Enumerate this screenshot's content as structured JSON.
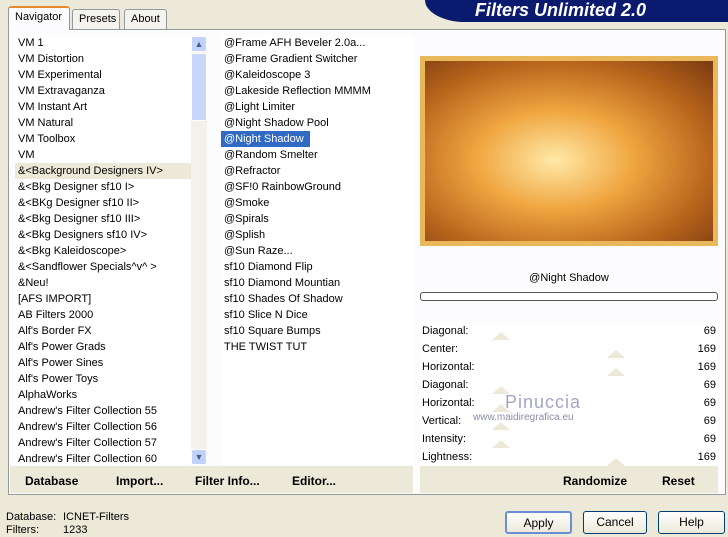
{
  "title": "Filters Unlimited 2.0",
  "tabs": [
    {
      "label": "Navigator",
      "active": true
    },
    {
      "label": "Presets"
    },
    {
      "label": "About"
    }
  ],
  "categories": [
    "VM 1",
    "VM Distortion",
    "VM Experimental",
    "VM Extravaganza",
    "VM Instant Art",
    "VM Natural",
    "VM Toolbox",
    "VM",
    "&<Background Designers IV>",
    "&<Bkg Designer sf10 I>",
    "&<BKg Designer sf10 II>",
    "&<Bkg Designer sf10 III>",
    "&<Bkg Designers sf10 IV>",
    "&<Bkg Kaleidoscope>",
    "&<Sandflower Specials^v^ >",
    "&Neu!",
    "[AFS IMPORT]",
    "AB Filters 2000",
    "Alf's Border FX",
    "Alf's Power Grads",
    "Alf's Power Sines",
    "Alf's Power Toys",
    "AlphaWorks",
    "Andrew's Filter Collection 55",
    "Andrew's Filter Collection 56",
    "Andrew's Filter Collection 57",
    "Andrew's Filter Collection 60"
  ],
  "selected_category": "&<Background Designers IV>",
  "filters": [
    "@Frame AFH Beveler 2.0a...",
    "@Frame Gradient Switcher",
    "@Kaleidoscope 3",
    "@Lakeside Reflection MMMM",
    "@Light Limiter",
    "@Night Shadow Pool",
    "@Night Shadow",
    "@Random Smelter",
    "@Refractor",
    "@SF!0 RainbowGround",
    "@Smoke",
    "@Spirals",
    "@Splish",
    "@Sun Raze...",
    "sf10 Diamond Flip",
    "sf10 Diamond Mountian",
    "sf10 Shades Of Shadow",
    "sf10 Slice N Dice",
    "sf10 Square Bumps",
    "THE TWIST TUT"
  ],
  "selected_filter": "@Night Shadow",
  "filter_name": "@Night Shadow",
  "progress": 0,
  "params": [
    {
      "label": "Diagonal:",
      "value": 69
    },
    {
      "label": "Center:",
      "value": 169
    },
    {
      "label": "Horizontal:",
      "value": 169
    },
    {
      "label": "Diagonal:",
      "value": 69
    },
    {
      "label": "Horizontal:",
      "value": 69
    },
    {
      "label": "Vertical:",
      "value": 69
    },
    {
      "label": "Intensity:",
      "value": 69
    },
    {
      "label": "Lightness:",
      "value": 169
    }
  ],
  "slider_max": 255,
  "watermark": {
    "name": "Pinuccia",
    "url": "www.maidiregrafica.eu"
  },
  "bottom_buttons": {
    "database": "Database",
    "import": "Import...",
    "filter_info": "Filter Info...",
    "editor": "Editor...",
    "randomize": "Randomize",
    "reset": "Reset"
  },
  "status": {
    "db_label": "Database:",
    "db_value": "ICNET-Filters",
    "filters_label": "Filters:",
    "filters_value": "1233"
  },
  "buttons": {
    "apply": "Apply",
    "cancel": "Cancel",
    "help": "Help"
  },
  "colors": {
    "accent": "#316ac5",
    "banner": "#0a1a6e"
  }
}
